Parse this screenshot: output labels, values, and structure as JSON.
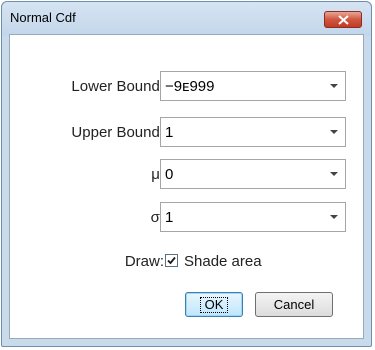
{
  "window": {
    "title": "Normal Cdf"
  },
  "fields": [
    {
      "label": "Lower Bound:",
      "value": "−9ᴇ999"
    },
    {
      "label": "Upper Bound:",
      "value": "1"
    },
    {
      "label": "μ:",
      "value": "0"
    },
    {
      "label": "σ:",
      "value": "1"
    }
  ],
  "draw": {
    "label": "Draw:",
    "checkbox_label": "Shade area",
    "checked": true
  },
  "buttons": {
    "ok": "OK",
    "cancel": "Cancel"
  },
  "colors": {
    "frame": "#c9daeb",
    "close_button": "#c94a34",
    "ok_button": "#bde6fd"
  },
  "icons": {
    "close": "close-icon",
    "dropdown": "chevron-down-icon",
    "check": "checkmark-icon"
  }
}
